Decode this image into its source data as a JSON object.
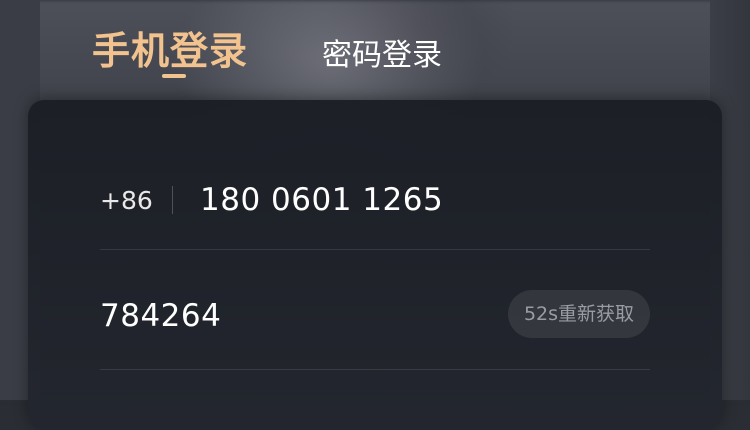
{
  "tabs": {
    "active_label": "手机登录",
    "inactive_label": "密码登录"
  },
  "phone_form": {
    "country_code": "+86",
    "phone_value": "180 0601 1265",
    "code_value": "784264",
    "resend_label": "52s重新获取"
  },
  "colors": {
    "accent": "#f2c38f",
    "card_bg": "#1f2229",
    "text_primary": "#ffffff",
    "text_muted": "#9a9ca3"
  }
}
